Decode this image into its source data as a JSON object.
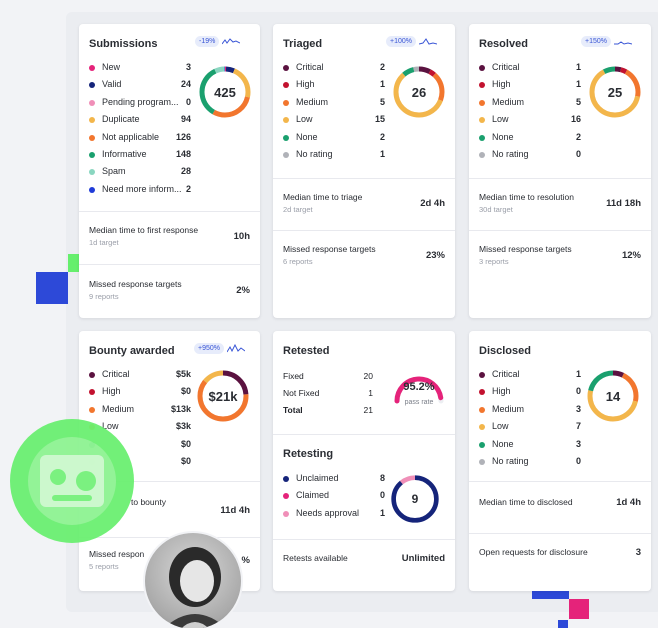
{
  "colors": {
    "critical": "#5b1240",
    "high": "#c2122f",
    "medium": "#f2762e",
    "low": "#f3b64b",
    "none": "#1aa06e",
    "no_rating": "#b0b2b8",
    "new": "#e5237a",
    "valid": "#15247a",
    "pending": "#f08fb8",
    "duplicate": "#f3b64b",
    "not_applicable": "#f2762e",
    "informative": "#1aa06e",
    "spam": "#8ad6c0",
    "need_more": "#1f3bd8",
    "accent_blue": "#2d49d8",
    "accent_pink": "#e5237a",
    "accent_green": "#66ef6d"
  },
  "submissions": {
    "title": "Submissions",
    "trend": "-19%",
    "total": "425",
    "items": [
      {
        "label": "New",
        "value": "3",
        "color_key": "new"
      },
      {
        "label": "Valid",
        "value": "24",
        "color_key": "valid"
      },
      {
        "label": "Pending program...",
        "value": "0",
        "color_key": "pending"
      },
      {
        "label": "Duplicate",
        "value": "94",
        "color_key": "duplicate"
      },
      {
        "label": "Not applicable",
        "value": "126",
        "color_key": "not_applicable"
      },
      {
        "label": "Informative",
        "value": "148",
        "color_key": "informative"
      },
      {
        "label": "Spam",
        "value": "28",
        "color_key": "spam"
      },
      {
        "label": "Need more inform...",
        "value": "2",
        "color_key": "need_more"
      }
    ],
    "metrics": [
      {
        "label": "Median time to first response",
        "sub": "1d target",
        "value": "10h"
      },
      {
        "label": "Missed response targets",
        "sub": "9 reports",
        "value": "2%"
      }
    ]
  },
  "triaged": {
    "title": "Triaged",
    "trend": "+100%",
    "total": "26",
    "items": [
      {
        "label": "Critical",
        "value": "2",
        "color_key": "critical"
      },
      {
        "label": "High",
        "value": "1",
        "color_key": "high"
      },
      {
        "label": "Medium",
        "value": "5",
        "color_key": "medium"
      },
      {
        "label": "Low",
        "value": "15",
        "color_key": "low"
      },
      {
        "label": "None",
        "value": "2",
        "color_key": "none"
      },
      {
        "label": "No rating",
        "value": "1",
        "color_key": "no_rating"
      }
    ],
    "metrics": [
      {
        "label": "Median time to triage",
        "sub": "2d target",
        "value": "2d 4h"
      },
      {
        "label": "Missed response targets",
        "sub": "6 reports",
        "value": "23%"
      }
    ]
  },
  "resolved": {
    "title": "Resolved",
    "trend": "+150%",
    "total": "25",
    "items": [
      {
        "label": "Critical",
        "value": "1",
        "color_key": "critical"
      },
      {
        "label": "High",
        "value": "1",
        "color_key": "high"
      },
      {
        "label": "Medium",
        "value": "5",
        "color_key": "medium"
      },
      {
        "label": "Low",
        "value": "16",
        "color_key": "low"
      },
      {
        "label": "None",
        "value": "2",
        "color_key": "none"
      },
      {
        "label": "No rating",
        "value": "0",
        "color_key": "no_rating"
      }
    ],
    "metrics": [
      {
        "label": "Median time to resolution",
        "sub": "30d target",
        "value": "11d 18h"
      },
      {
        "label": "Missed response targets",
        "sub": "3 reports",
        "value": "12%"
      }
    ]
  },
  "bounty": {
    "title": "Bounty awarded",
    "trend": "+950%",
    "total": "$21k",
    "items": [
      {
        "label": "Critical",
        "value": "$5k",
        "color_key": "critical",
        "weight": 5
      },
      {
        "label": "High",
        "value": "$0",
        "color_key": "high",
        "weight": 0
      },
      {
        "label": "Medium",
        "value": "$13k",
        "color_key": "medium",
        "weight": 13
      },
      {
        "label": "Low",
        "value": "$3k",
        "color_key": "low",
        "weight": 3
      },
      {
        "label": "",
        "value": "$0",
        "color_key": "none",
        "weight": 0
      },
      {
        "label": "",
        "value": "$0",
        "color_key": "no_rating",
        "weight": 0
      }
    ],
    "metrics": [
      {
        "label": "to bounty",
        "sub": "",
        "value": "11d 4h"
      },
      {
        "label": "Missed respon",
        "sub": "5 reports",
        "value": "%"
      }
    ]
  },
  "retested": {
    "title": "Retested",
    "rows": [
      {
        "label": "Fixed",
        "value": "20"
      },
      {
        "label": "Not Fixed",
        "value": "1"
      },
      {
        "label": "Total",
        "value": "21"
      }
    ],
    "pass_rate": "95.2%",
    "pass_rate_value": 0.952,
    "pass_label": "pass rate"
  },
  "retesting": {
    "title": "Retesting",
    "total": "9",
    "items": [
      {
        "label": "Unclaimed",
        "value": "8",
        "color_key": "valid"
      },
      {
        "label": "Claimed",
        "value": "0",
        "color_key": "new"
      },
      {
        "label": "Needs approval",
        "value": "1",
        "color_key": "pending"
      }
    ],
    "metrics": [
      {
        "label": "Retests available",
        "value": "Unlimited"
      }
    ]
  },
  "disclosed": {
    "title": "Disclosed",
    "total": "14",
    "items": [
      {
        "label": "Critical",
        "value": "1",
        "color_key": "critical"
      },
      {
        "label": "High",
        "value": "0",
        "color_key": "high"
      },
      {
        "label": "Medium",
        "value": "3",
        "color_key": "medium"
      },
      {
        "label": "Low",
        "value": "7",
        "color_key": "low"
      },
      {
        "label": "None",
        "value": "3",
        "color_key": "none"
      },
      {
        "label": "No rating",
        "value": "0",
        "color_key": "no_rating"
      }
    ],
    "metrics": [
      {
        "label": "Median time to disclosed",
        "value": "1d 4h"
      },
      {
        "label": "Open requests for disclosure",
        "value": "3"
      }
    ]
  }
}
